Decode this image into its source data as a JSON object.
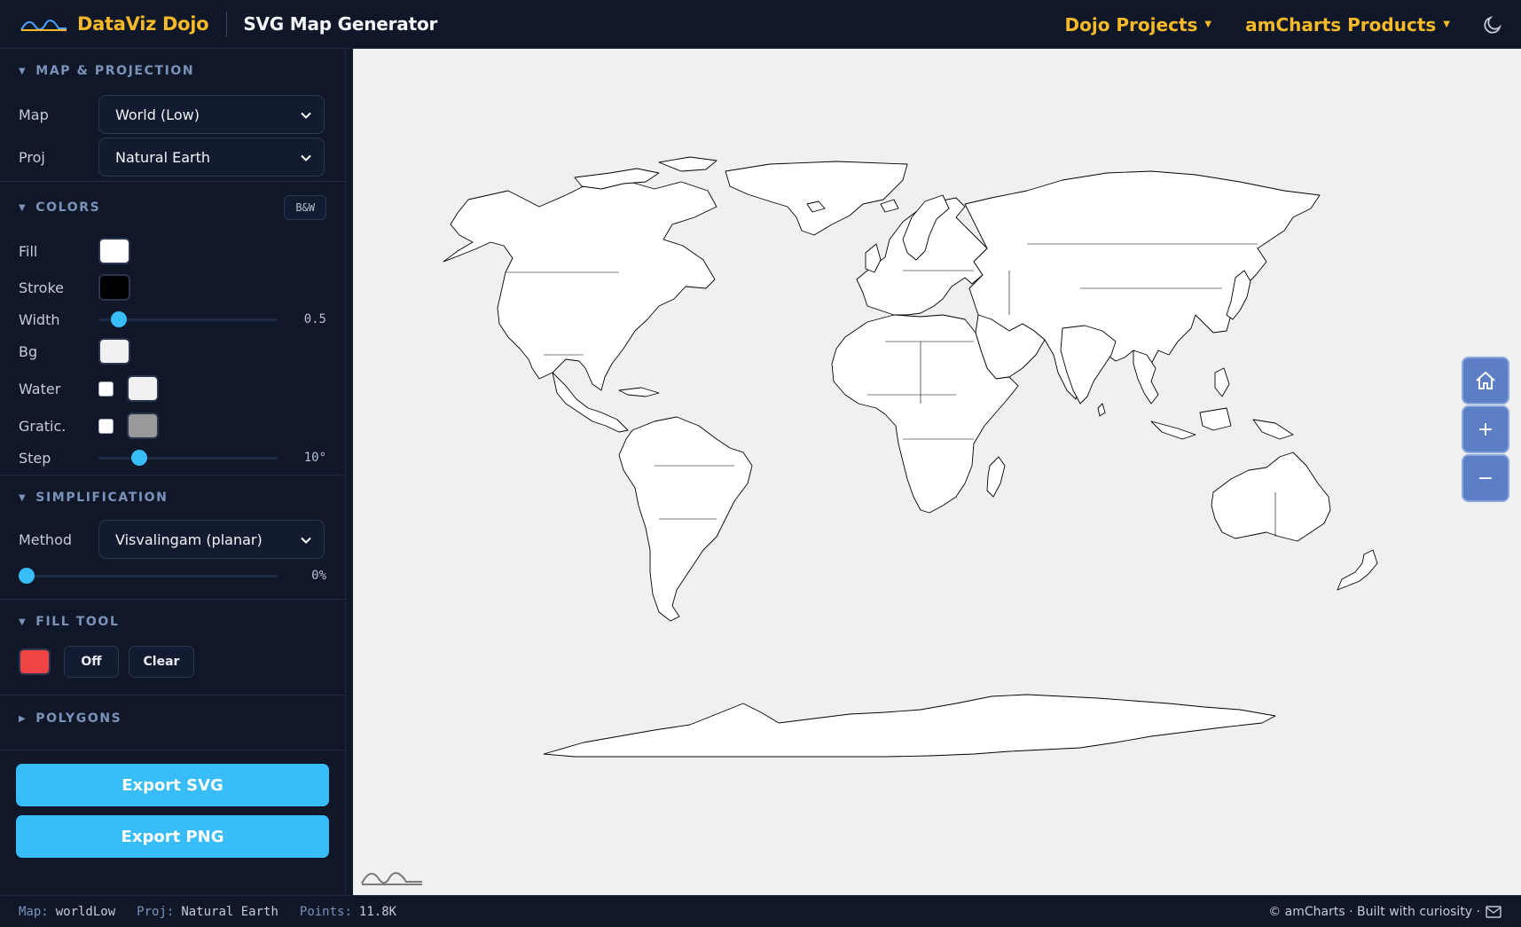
{
  "header": {
    "brand": "DataViz Dojo",
    "title": "SVG Map Generator",
    "nav": [
      {
        "label": "Dojo Projects"
      },
      {
        "label": "amCharts Products"
      }
    ],
    "theme_icon": "moon-icon"
  },
  "sidebar": {
    "map_section": {
      "title": "MAP & PROJECTION",
      "map_label": "Map",
      "map_value": "World (Low)",
      "proj_label": "Proj",
      "proj_value": "Natural Earth"
    },
    "colors_section": {
      "title": "COLORS",
      "bw_button": "B&W",
      "fill_label": "Fill",
      "fill_color": "#ffffff",
      "stroke_label": "Stroke",
      "stroke_color": "#000000",
      "width_label": "Width",
      "width_value": "0.5",
      "width_fraction": 0.12,
      "bg_label": "Bg",
      "bg_color": "#f0f0f0",
      "water_label": "Water",
      "water_color": "#f0f0f0",
      "water_checked": false,
      "gratic_label": "Gratic.",
      "gratic_color": "#999999",
      "gratic_checked": false,
      "step_label": "Step",
      "step_value": "10°",
      "step_fraction": 0.23
    },
    "simplification_section": {
      "title": "SIMPLIFICATION",
      "method_label": "Method",
      "method_value": "Visvalingam (planar)",
      "amount_value": "0%",
      "amount_fraction": 0
    },
    "fill_tool_section": {
      "title": "FILL TOOL",
      "tool_color": "#ef4444",
      "off_button": "Off",
      "clear_button": "Clear"
    },
    "polygons_section": {
      "title": "POLYGONS"
    },
    "export_svg": "Export SVG",
    "export_png": "Export PNG"
  },
  "map_controls": {
    "home_icon": "home-icon",
    "zoom_in": "+",
    "zoom_out": "−"
  },
  "footer": {
    "map_key": "Map:",
    "map_val": "worldLow",
    "proj_key": "Proj:",
    "proj_val": "Natural Earth",
    "points_key": "Points:",
    "points_val": "11.8K",
    "credit": "© amCharts · Built with curiosity ·",
    "mail_icon": "mail-icon"
  },
  "colors": {
    "accent": "#38bdf8",
    "brand": "#f6b928",
    "background": "#0f1729"
  }
}
